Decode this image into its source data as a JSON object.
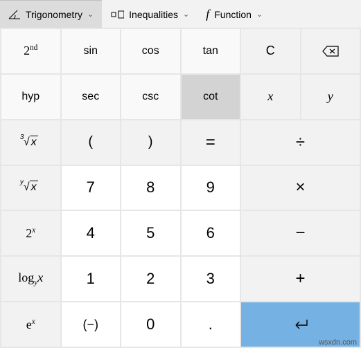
{
  "menubar": {
    "trig": {
      "label": "Trigonometry"
    },
    "ineq": {
      "label": "Inequalities"
    },
    "func": {
      "label": "Function"
    }
  },
  "trig_panel": {
    "second": "2",
    "second_sup": "nd",
    "sin": "sin",
    "cos": "cos",
    "tan": "tan",
    "hyp": "hyp",
    "sec": "sec",
    "csc": "csc",
    "cot": "cot"
  },
  "right_panel": {
    "clear": "C",
    "var_x": "x",
    "var_y": "y"
  },
  "funcs": {
    "cuberoot_deg": "3",
    "cuberoot_x": "x",
    "nroot_deg": "y",
    "nroot_x": "x",
    "two_pow_base": "2",
    "two_pow_exp": "x",
    "log_base": "y",
    "log_arg": "x",
    "log_label": "log",
    "e_base": "e",
    "e_exp": "x"
  },
  "paren_open": "(",
  "paren_close": ")",
  "negate": "(−)",
  "dot": ".",
  "digits": {
    "d0": "0",
    "d1": "1",
    "d2": "2",
    "d3": "3",
    "d4": "4",
    "d5": "5",
    "d6": "6",
    "d7": "7",
    "d8": "8",
    "d9": "9"
  },
  "ops": {
    "equals": "=",
    "divide": "÷",
    "multiply": "×",
    "minus": "−",
    "plus": "+"
  },
  "watermark": "wsxdn.com"
}
